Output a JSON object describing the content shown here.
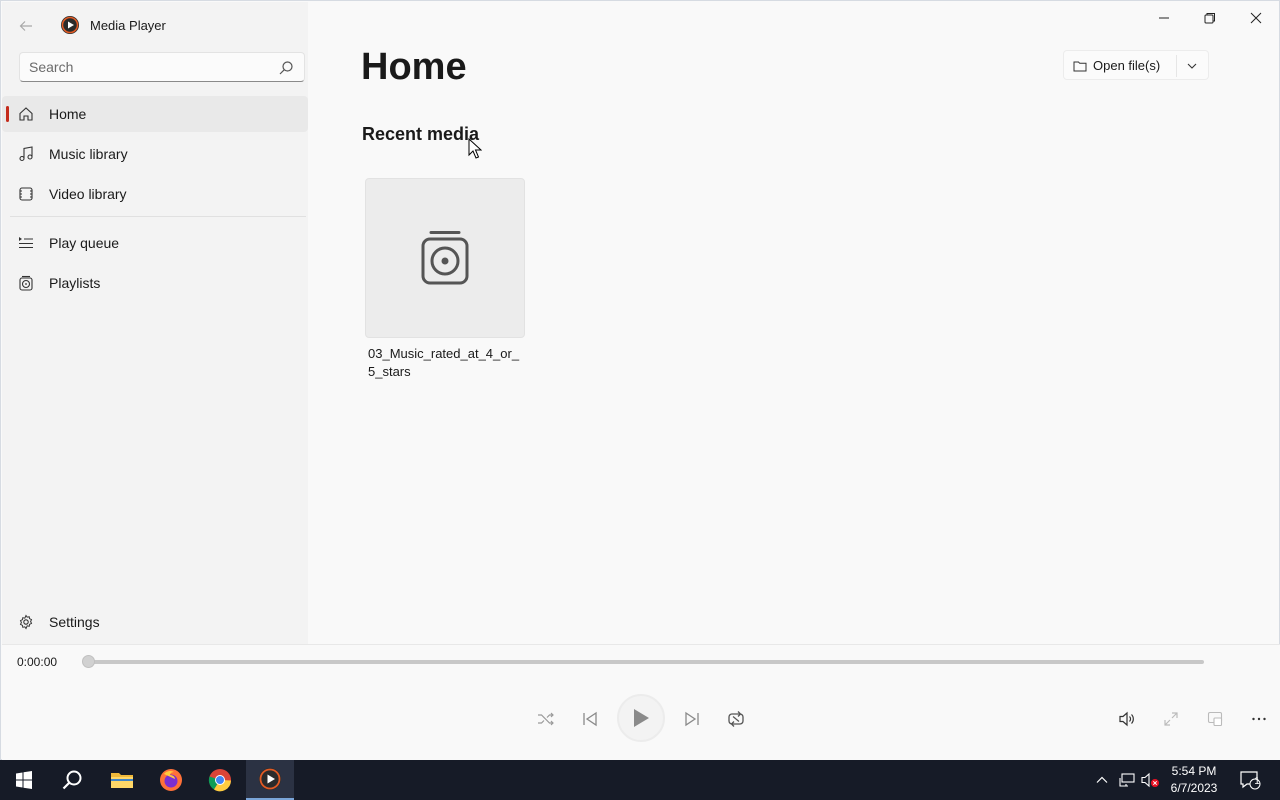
{
  "app": {
    "title": "Media Player"
  },
  "search": {
    "placeholder": "Search",
    "value": ""
  },
  "nav": {
    "items": [
      {
        "label": "Home",
        "icon": "home-icon",
        "active": true
      },
      {
        "label": "Music library",
        "icon": "music-note-icon"
      },
      {
        "label": "Video library",
        "icon": "film-icon"
      }
    ],
    "secondary": [
      {
        "label": "Play queue",
        "icon": "play-queue-icon"
      },
      {
        "label": "Playlists",
        "icon": "playlist-icon"
      }
    ],
    "settings": {
      "label": "Settings",
      "icon": "gear-icon"
    }
  },
  "main": {
    "page_title": "Home",
    "open_files_label": "Open file(s)",
    "section_title": "Recent media",
    "recent": [
      {
        "title": "03_Music_rated_at_4_or_5_stars",
        "icon": "playlist-icon"
      }
    ]
  },
  "player": {
    "current_time": "0:00:00",
    "progress": 0.0
  },
  "taskbar": {
    "time": "5:54 PM",
    "date": "6/7/2023",
    "notification_count": "1"
  },
  "colors": {
    "accent": "#c42b1c",
    "sidebar_bg": "#f3f3f3",
    "content_bg": "#f9f9f9",
    "taskbar_bg": "#161b27"
  }
}
